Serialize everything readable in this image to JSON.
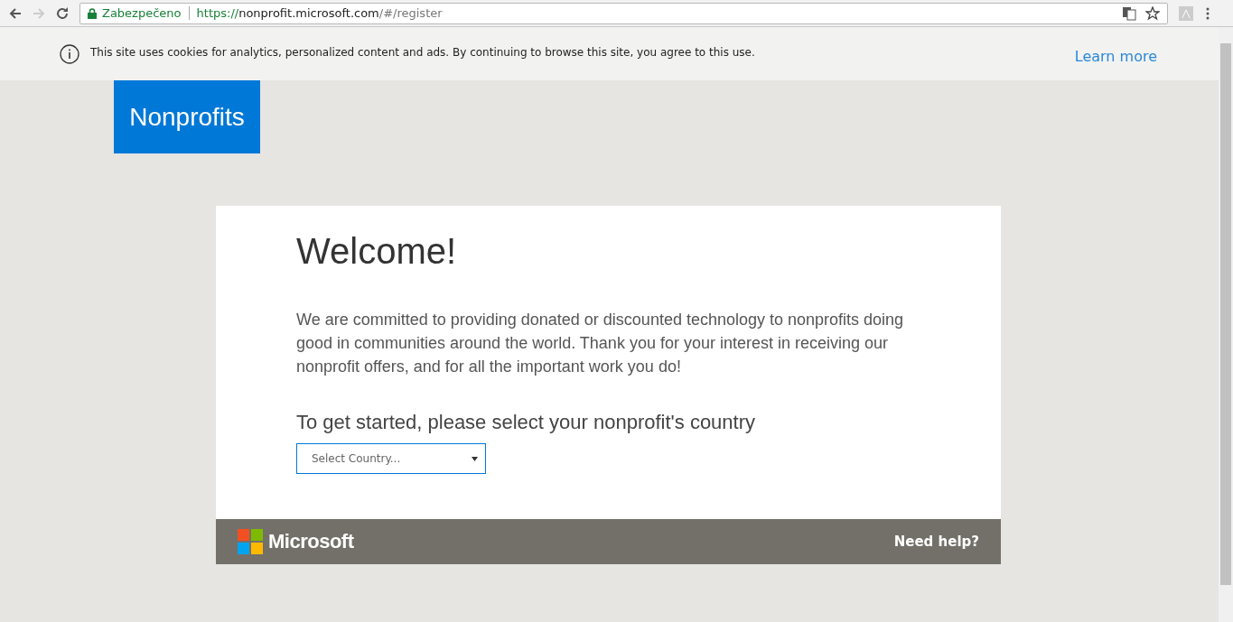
{
  "browser": {
    "security_label": "Zabezpečeno",
    "url": {
      "scheme": "https://",
      "host": "nonprofit.microsoft.com",
      "path": "/#/register"
    }
  },
  "cookie_banner": {
    "text": "This site uses cookies for analytics, personalized content and ads. By continuing to browse this site, you agree to this use.",
    "link": "Learn more"
  },
  "logo": {
    "text": "Nonprofits"
  },
  "card": {
    "title": "Welcome!",
    "intro": "We are committed to providing donated or discounted technology to nonprofits doing good in communities around the world. Thank you for your interest in receiving our nonprofit offers, and for all the important work you do!",
    "prompt": "To get started, please select your nonprofit's country",
    "country_select": {
      "placeholder": "Select Country..."
    }
  },
  "footer": {
    "brand": "Microsoft",
    "help_link": "Need help?"
  }
}
